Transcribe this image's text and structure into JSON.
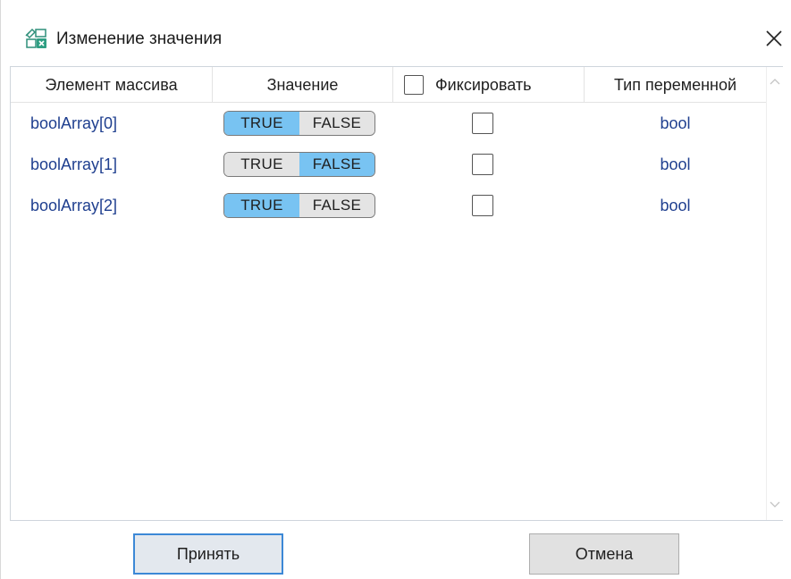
{
  "window": {
    "title": "Изменение значения"
  },
  "table": {
    "columns": [
      "Элемент массива",
      "Значение",
      "Фиксировать",
      "Тип переменной"
    ],
    "rows": [
      {
        "name": "boolArray[0]",
        "true_label": "TRUE",
        "false_label": "FALSE",
        "value": "TRUE",
        "fixed": false,
        "type": "bool"
      },
      {
        "name": "boolArray[1]",
        "true_label": "TRUE",
        "false_label": "FALSE",
        "value": "FALSE",
        "fixed": false,
        "type": "bool"
      },
      {
        "name": "boolArray[2]",
        "true_label": "TRUE",
        "false_label": "FALSE",
        "value": "TRUE",
        "fixed": false,
        "type": "bool"
      }
    ]
  },
  "buttons": {
    "accept": "Принять",
    "cancel": "Отмена"
  },
  "colors": {
    "toggle_selected": "#78c3f2",
    "toggle_unselected": "#e4e4e4",
    "link_text": "#1f3f8f",
    "accept_border": "#3c88d6"
  },
  "icons": {
    "title": "variable-edit-icon",
    "close": "close-icon",
    "scroll_up": "chevron-up-icon",
    "scroll_down": "chevron-down-icon"
  }
}
